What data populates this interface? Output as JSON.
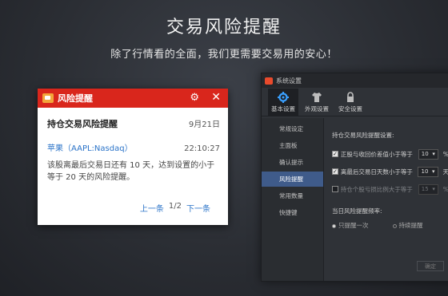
{
  "hero": {
    "headline": "交易风险提醒",
    "subline": "除了行情看的全面，我们更需要交易用的安心！"
  },
  "settings_window": {
    "title": "系统设置",
    "toolbar": [
      {
        "label": "基本设置",
        "icon": "gear-icon",
        "active": true
      },
      {
        "label": "外观设置",
        "icon": "shirt-icon",
        "active": false
      },
      {
        "label": "安全设置",
        "icon": "lock-icon",
        "active": false
      }
    ],
    "nav": [
      "常规设定",
      "主面板",
      "确认提示",
      "风险提醒",
      "常用数量",
      "快捷键"
    ],
    "active_nav": "风险提醒",
    "section_title": "持仓交易风险提醒设置:",
    "options": [
      {
        "label": "正股与收回价差值小于等于",
        "checked": true,
        "value": "10",
        "unit": "%",
        "enabled": true
      },
      {
        "label": "离最后交易日天数小于等于",
        "checked": true,
        "value": "10",
        "unit": "天",
        "enabled": true
      },
      {
        "label": "持仓个股亏损比例大于等于",
        "checked": false,
        "value": "15",
        "unit": "%",
        "enabled": false
      }
    ],
    "frequency_title": "当日风险提醒频率:",
    "frequency_options": [
      "只提醒一次",
      "持续提醒"
    ],
    "frequency_selected": "只提醒一次",
    "confirm_label": "确定"
  },
  "alert_popup": {
    "title": "风险提醒",
    "header_title": "持仓交易风险提醒",
    "date": "9月21日",
    "stock": "苹果（AAPL:Nasdaq）",
    "time": "22:10:27",
    "message": "该股离最后交易日还有 10 天，达到设置的小于等于 20 天的风险提醒。",
    "prev_label": "上一条",
    "page_count": "1/2",
    "next_label": "下一条"
  },
  "colors": {
    "alert_header": "#d9261c",
    "link": "#2a73c8",
    "active_nav": "#3f5b8a"
  }
}
